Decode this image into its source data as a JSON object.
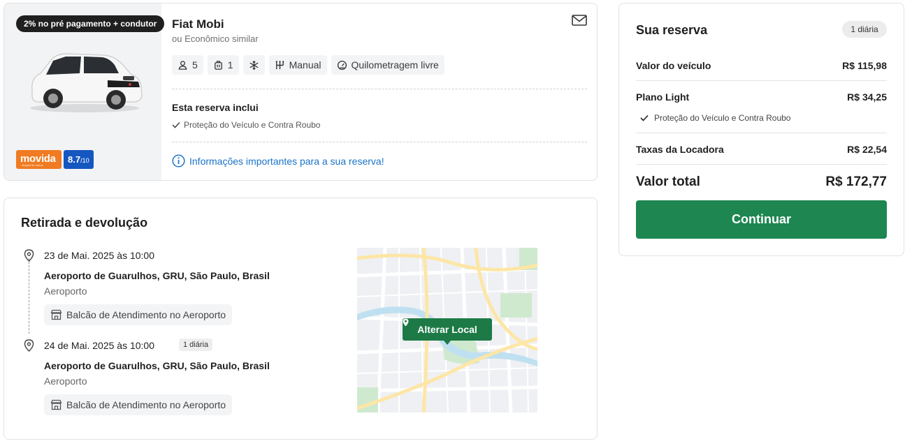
{
  "car": {
    "promo_badge": "2% no pré pagamento + condutor",
    "title": "Fiat Mobi",
    "subtitle": "ou Econômico similar",
    "brand": "movida",
    "brand_tagline": "aluguel de carros",
    "score": "8.7",
    "score_scale": "/10",
    "features": {
      "passengers": "5",
      "luggage": "1",
      "transmission": "Manual",
      "mileage": "Quilometragem livre"
    },
    "includes_title": "Esta reserva inclui",
    "includes_item": "Proteção do Veículo e Contra Roubo",
    "info_link": "Informações importantes para a sua reserva!"
  },
  "pickup": {
    "title": "Retirada e devolução",
    "pickup_date": "23 de Mai. 2025 às 10:00",
    "pickup_location": "Aeroporto de Guarulhos, GRU, São Paulo, Brasil",
    "pickup_type": "Aeroporto",
    "pickup_counter": "Balcão de Atendimento no Aeroporto",
    "return_date": "24 de Mai. 2025 às 10:00",
    "return_chip": "1 diária",
    "return_location": "Aeroporto de Guarulhos, GRU, São Paulo, Brasil",
    "return_type": "Aeroporto",
    "return_counter": "Balcão de Atendimento no Aeroporto",
    "map_button": "Alterar Local"
  },
  "summary": {
    "title": "Sua reserva",
    "chip": "1 diária",
    "vehicle_label": "Valor do veículo",
    "vehicle_value": "R$ 115,98",
    "plan_label": "Plano Light",
    "plan_value": "R$ 34,25",
    "plan_item": "Proteção do Veículo e Contra Roubo",
    "fees_label": "Taxas da Locadora",
    "fees_value": "R$ 22,54",
    "total_label": "Valor total",
    "total_value": "R$ 172,77",
    "continue_label": "Continuar"
  },
  "colors": {
    "primary_green": "#1d8651",
    "map_button_green": "#1d7a46",
    "link_blue": "#1a73c8",
    "brand_orange": "#f07b22",
    "score_blue": "#1557c0"
  }
}
